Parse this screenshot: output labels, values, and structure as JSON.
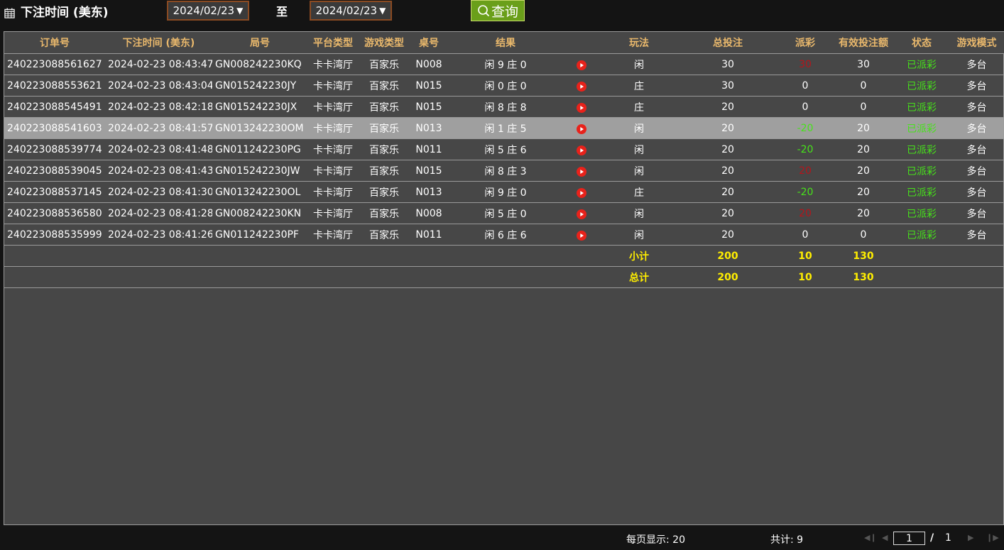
{
  "filter": {
    "title": "下注时间 (美东)",
    "start_date": "2024/02/23",
    "end_date": "2024/02/23",
    "to_label": "至",
    "query_label": "查询",
    "arrow": "▼"
  },
  "table": {
    "headers": [
      "订单号",
      "下注时间 (美东)",
      "局号",
      "平台类型",
      "游戏类型",
      "桌号",
      "结果",
      "",
      "玩法",
      "总投注",
      "派彩",
      "有效投注额",
      "状态",
      "游戏模式"
    ],
    "rows": [
      {
        "order": "240223088561627",
        "time": "2024-02-23 08:43:47",
        "round": "GN008242230KQ",
        "platform": "卡卡湾厅",
        "game": "百家乐",
        "table": "N008",
        "result": "闲 9 庄 0",
        "play": "闲",
        "bet": "30",
        "payout": "30",
        "payout_color": "red",
        "valid": "30",
        "status": "已派彩",
        "mode": "多台"
      },
      {
        "order": "240223088553621",
        "time": "2024-02-23 08:43:04",
        "round": "GN015242230JY",
        "platform": "卡卡湾厅",
        "game": "百家乐",
        "table": "N015",
        "result": "闲 0 庄 0",
        "play": "庄",
        "bet": "30",
        "payout": "0",
        "payout_color": "white",
        "valid": "0",
        "status": "已派彩",
        "mode": "多台"
      },
      {
        "order": "240223088545491",
        "time": "2024-02-23 08:42:18",
        "round": "GN015242230JX",
        "platform": "卡卡湾厅",
        "game": "百家乐",
        "table": "N015",
        "result": "闲 8 庄 8",
        "play": "庄",
        "bet": "20",
        "payout": "0",
        "payout_color": "white",
        "valid": "0",
        "status": "已派彩",
        "mode": "多台"
      },
      {
        "order": "240223088541603",
        "time": "2024-02-23 08:41:57",
        "round": "GN013242230OM",
        "platform": "卡卡湾厅",
        "game": "百家乐",
        "table": "N013",
        "result": "闲 1 庄 5",
        "play": "闲",
        "bet": "20",
        "payout": "-20",
        "payout_color": "green",
        "valid": "20",
        "status": "已派彩",
        "mode": "多台",
        "selected": true
      },
      {
        "order": "240223088539774",
        "time": "2024-02-23 08:41:48",
        "round": "GN011242230PG",
        "platform": "卡卡湾厅",
        "game": "百家乐",
        "table": "N011",
        "result": "闲 5 庄 6",
        "play": "闲",
        "bet": "20",
        "payout": "-20",
        "payout_color": "green",
        "valid": "20",
        "status": "已派彩",
        "mode": "多台"
      },
      {
        "order": "240223088539045",
        "time": "2024-02-23 08:41:43",
        "round": "GN015242230JW",
        "platform": "卡卡湾厅",
        "game": "百家乐",
        "table": "N015",
        "result": "闲 8 庄 3",
        "play": "闲",
        "bet": "20",
        "payout": "20",
        "payout_color": "red",
        "valid": "20",
        "status": "已派彩",
        "mode": "多台"
      },
      {
        "order": "240223088537145",
        "time": "2024-02-23 08:41:30",
        "round": "GN013242230OL",
        "platform": "卡卡湾厅",
        "game": "百家乐",
        "table": "N013",
        "result": "闲 9 庄 0",
        "play": "庄",
        "bet": "20",
        "payout": "-20",
        "payout_color": "green",
        "valid": "20",
        "status": "已派彩",
        "mode": "多台"
      },
      {
        "order": "240223088536580",
        "time": "2024-02-23 08:41:28",
        "round": "GN008242230KN",
        "platform": "卡卡湾厅",
        "game": "百家乐",
        "table": "N008",
        "result": "闲 5 庄 0",
        "play": "闲",
        "bet": "20",
        "payout": "20",
        "payout_color": "red",
        "valid": "20",
        "status": "已派彩",
        "mode": "多台"
      },
      {
        "order": "240223088535999",
        "time": "2024-02-23 08:41:26",
        "round": "GN011242230PF",
        "platform": "卡卡湾厅",
        "game": "百家乐",
        "table": "N011",
        "result": "闲 6 庄 6",
        "play": "闲",
        "bet": "20",
        "payout": "0",
        "payout_color": "white",
        "valid": "0",
        "status": "已派彩",
        "mode": "多台"
      }
    ],
    "subtotal": {
      "label": "小计",
      "bet": "200",
      "payout": "10",
      "valid": "130"
    },
    "total": {
      "label": "总计",
      "bet": "200",
      "payout": "10",
      "valid": "130"
    }
  },
  "footer": {
    "per_page": "每页显示: 20",
    "total_count": "共计: 9",
    "current_page": "1",
    "slash": "/",
    "total_pages": "1"
  },
  "colors": {
    "red": "#b5151b",
    "green": "#47e21a",
    "yellow": "#ffee00",
    "header_gold": "#e9b86c",
    "query_green": "#6a9f1a"
  },
  "icons": {
    "calendar": "calendar-icon",
    "search": "search-icon",
    "play": "play-icon",
    "first": "first-page-icon",
    "prev": "prev-page-icon",
    "next": "next-page-icon",
    "last": "last-page-icon"
  }
}
